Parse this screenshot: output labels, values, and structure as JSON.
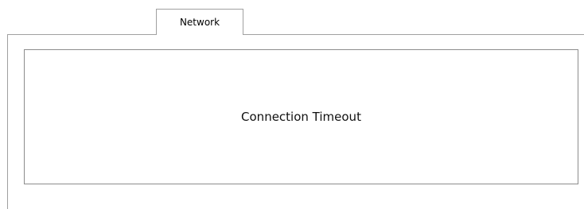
{
  "tabs": [
    {
      "label": "Network",
      "selected": true
    }
  ],
  "content": {
    "message": "Connection Timeout"
  },
  "colors": {
    "border": "#a0a0a0",
    "background": "#ffffff"
  }
}
